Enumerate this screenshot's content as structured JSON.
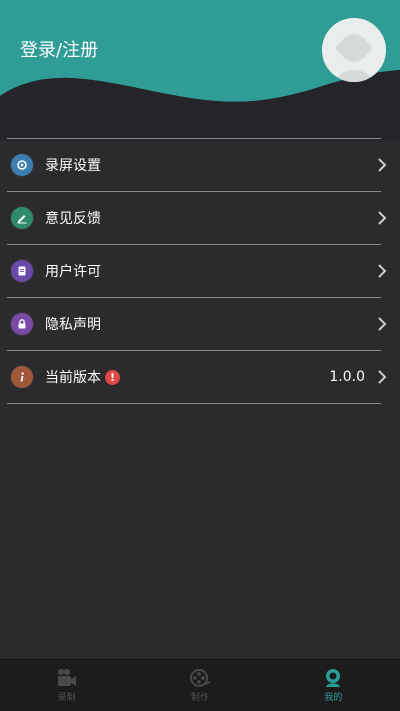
{
  "header": {
    "login_label": "登录/注册",
    "accent_color": "#2f9c96"
  },
  "menu": {
    "items": [
      {
        "label": "录屏设置",
        "icon": "settings-icon",
        "color": "#3a7fb0"
      },
      {
        "label": "意见反馈",
        "icon": "edit-icon",
        "color": "#2f8a6e"
      },
      {
        "label": "用户许可",
        "icon": "document-icon",
        "color": "#6a4aa8"
      },
      {
        "label": "隐私声明",
        "icon": "lock-icon",
        "color": "#7b4aa8"
      },
      {
        "label": "当前版本",
        "icon": "info-icon",
        "color": "#a0583a",
        "badge": "!",
        "value": "1.0.0"
      }
    ]
  },
  "tabbar": {
    "tabs": [
      {
        "label": "录制",
        "icon": "video-camera-icon",
        "active": false
      },
      {
        "label": "制作",
        "icon": "film-reel-icon",
        "active": false
      },
      {
        "label": "我的",
        "icon": "user-icon",
        "active": true
      }
    ]
  }
}
